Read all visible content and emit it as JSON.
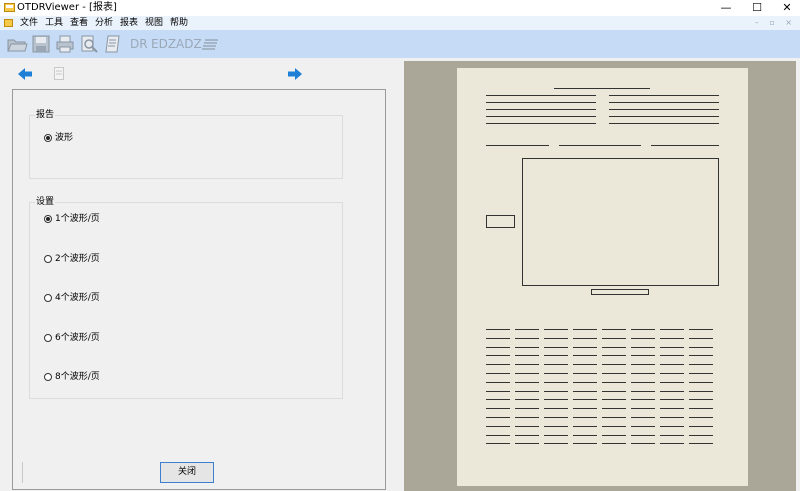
{
  "window": {
    "title": "OTDRViewer - [报表]",
    "controls": {
      "minimize": "—",
      "maximize": "☐",
      "close": "✕"
    }
  },
  "menu": {
    "items": [
      "文件",
      "工具",
      "查看",
      "分析",
      "报表",
      "视图",
      "帮助"
    ],
    "mdi_controls": "– ▫ ×"
  },
  "toolbar": {
    "icons": [
      "open-folder-icon",
      "save-icon",
      "print-icon",
      "print-preview-icon",
      "document-icon"
    ],
    "text_buttons": [
      "DR",
      "EDZ",
      "ADZ"
    ],
    "last_icon": "align-lines-icon"
  },
  "report_group": {
    "label": "报告",
    "options": [
      {
        "label": "波形",
        "checked": true
      }
    ]
  },
  "settings_group": {
    "label": "设置",
    "options": [
      {
        "label": "1个波形/页",
        "checked": true
      },
      {
        "label": "2个波形/页",
        "checked": false
      },
      {
        "label": "4个波形/页",
        "checked": false
      },
      {
        "label": "6个波形/页",
        "checked": false
      },
      {
        "label": "8个波形/页",
        "checked": false
      }
    ]
  },
  "buttons": {
    "close": "关闭"
  },
  "colors": {
    "toolbar": "#c6dbf5",
    "menubar": "#eaf2fb",
    "nav_arrow": "#1e7fd6",
    "preview_bg": "#aaa799",
    "page_bg": "#ebe8d9"
  }
}
